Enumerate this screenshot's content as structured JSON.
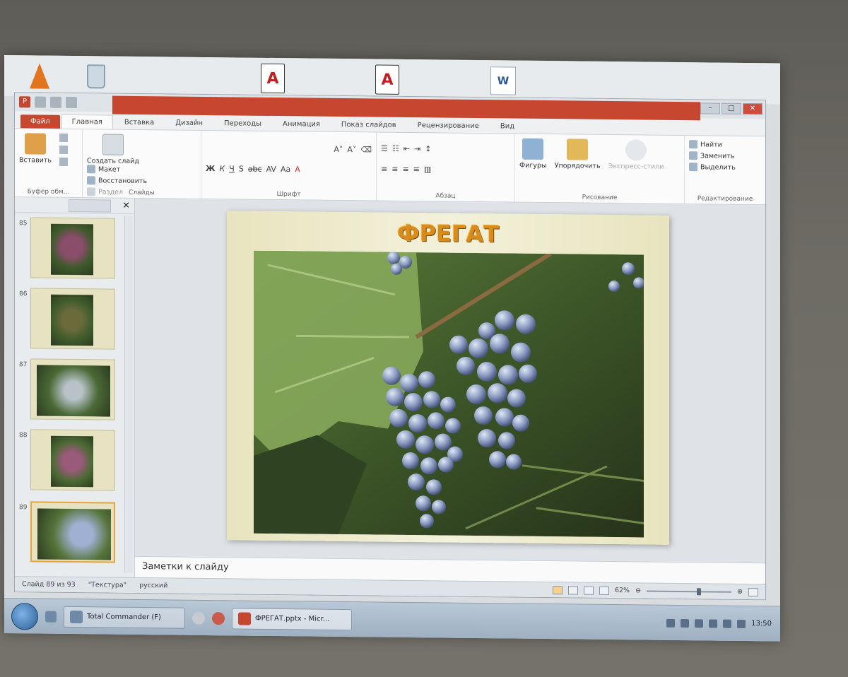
{
  "window": {
    "app_icon_label": "P"
  },
  "ribbon": {
    "tabs": [
      {
        "label": "Файл"
      },
      {
        "label": "Главная"
      },
      {
        "label": "Вставка"
      },
      {
        "label": "Дизайн"
      },
      {
        "label": "Переходы"
      },
      {
        "label": "Анимация"
      },
      {
        "label": "Показ слайдов"
      },
      {
        "label": "Рецензирование"
      },
      {
        "label": "Вид"
      }
    ],
    "clipboard": {
      "paste_label": "Вставить",
      "group_label": "Буфер обм..."
    },
    "slides": {
      "create_label": "Создать слайд",
      "layout_label": "Макет",
      "reset_label": "Восстановить",
      "section_label": "Раздел",
      "group_label": "Слайды"
    },
    "font": {
      "group_label": "Шрифт"
    },
    "paragraph": {
      "group_label": "Абзац"
    },
    "drawing": {
      "shapes_label": "Фигуры",
      "arrange_label": "Упорядочить",
      "quick_styles_label": "Экспресс-стили",
      "group_label": "Рисование"
    },
    "editing": {
      "find_label": "Найти",
      "replace_label": "Заменить",
      "select_label": "Выделить",
      "group_label": "Редактирование"
    }
  },
  "thumbnails": [
    {
      "number": "85",
      "selected": false
    },
    {
      "number": "86",
      "selected": false
    },
    {
      "number": "87",
      "selected": false
    },
    {
      "number": "88",
      "selected": false
    },
    {
      "number": "89",
      "selected": true
    }
  ],
  "slide": {
    "title": "ФРЕГАТ"
  },
  "notes": {
    "placeholder": "Заметки к слайду"
  },
  "statusbar": {
    "slide_info": "Слайд 89 из 93",
    "theme": "\"Текстура\"",
    "language": "русский",
    "zoom": "62%",
    "zoom_level": 0.62
  },
  "taskbar": {
    "item1": "Total Commander (F)",
    "item2": "ФРЕГАТ.pptx - Micr...",
    "clock": "13:50"
  },
  "colors": {
    "accent": "#c7462f",
    "title_gold": "#d98b1c"
  }
}
